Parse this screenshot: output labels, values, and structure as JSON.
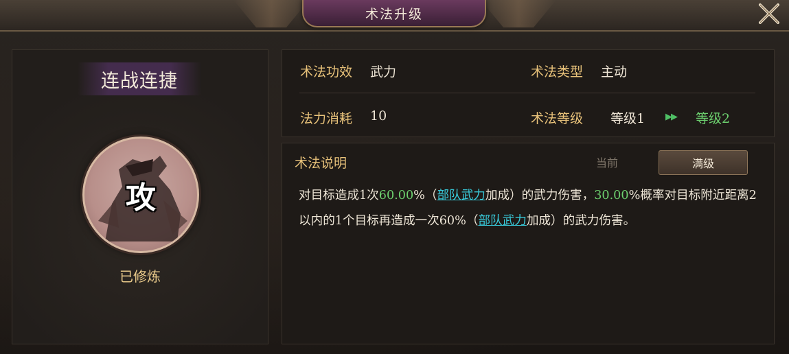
{
  "window": {
    "title": "术法升级",
    "close_icon": "close-x-icon"
  },
  "skill": {
    "name": "连战连捷",
    "icon_char": "攻",
    "status": "已修炼"
  },
  "info": {
    "effect_label": "术法功效",
    "effect_value": "武力",
    "type_label": "术法类型",
    "type_value": "主动",
    "cost_label": "法力消耗",
    "cost_value": "10",
    "level_label": "术法等级",
    "level_current": "等级1",
    "level_next": "等级2"
  },
  "description": {
    "title": "术法说明",
    "tab_current": "当前",
    "tab_max": "满级",
    "parts": {
      "p1": "对目标造成1次",
      "n1": "60.00",
      "p2": "%（",
      "link1": "部队武力",
      "p3": "加成）的武力伤害，",
      "n2": "30.00",
      "p4": "%概率对目标附近距离2以内的1个目标再造成一次60%（",
      "link2": "部队武力",
      "p5": "加成）的武力伤害。"
    }
  },
  "colors": {
    "label_gold": "#e8c27a",
    "highlight_green": "#6ccf6e",
    "link_cyan": "#38c8d8",
    "title_plate": "#6a3a5e"
  }
}
